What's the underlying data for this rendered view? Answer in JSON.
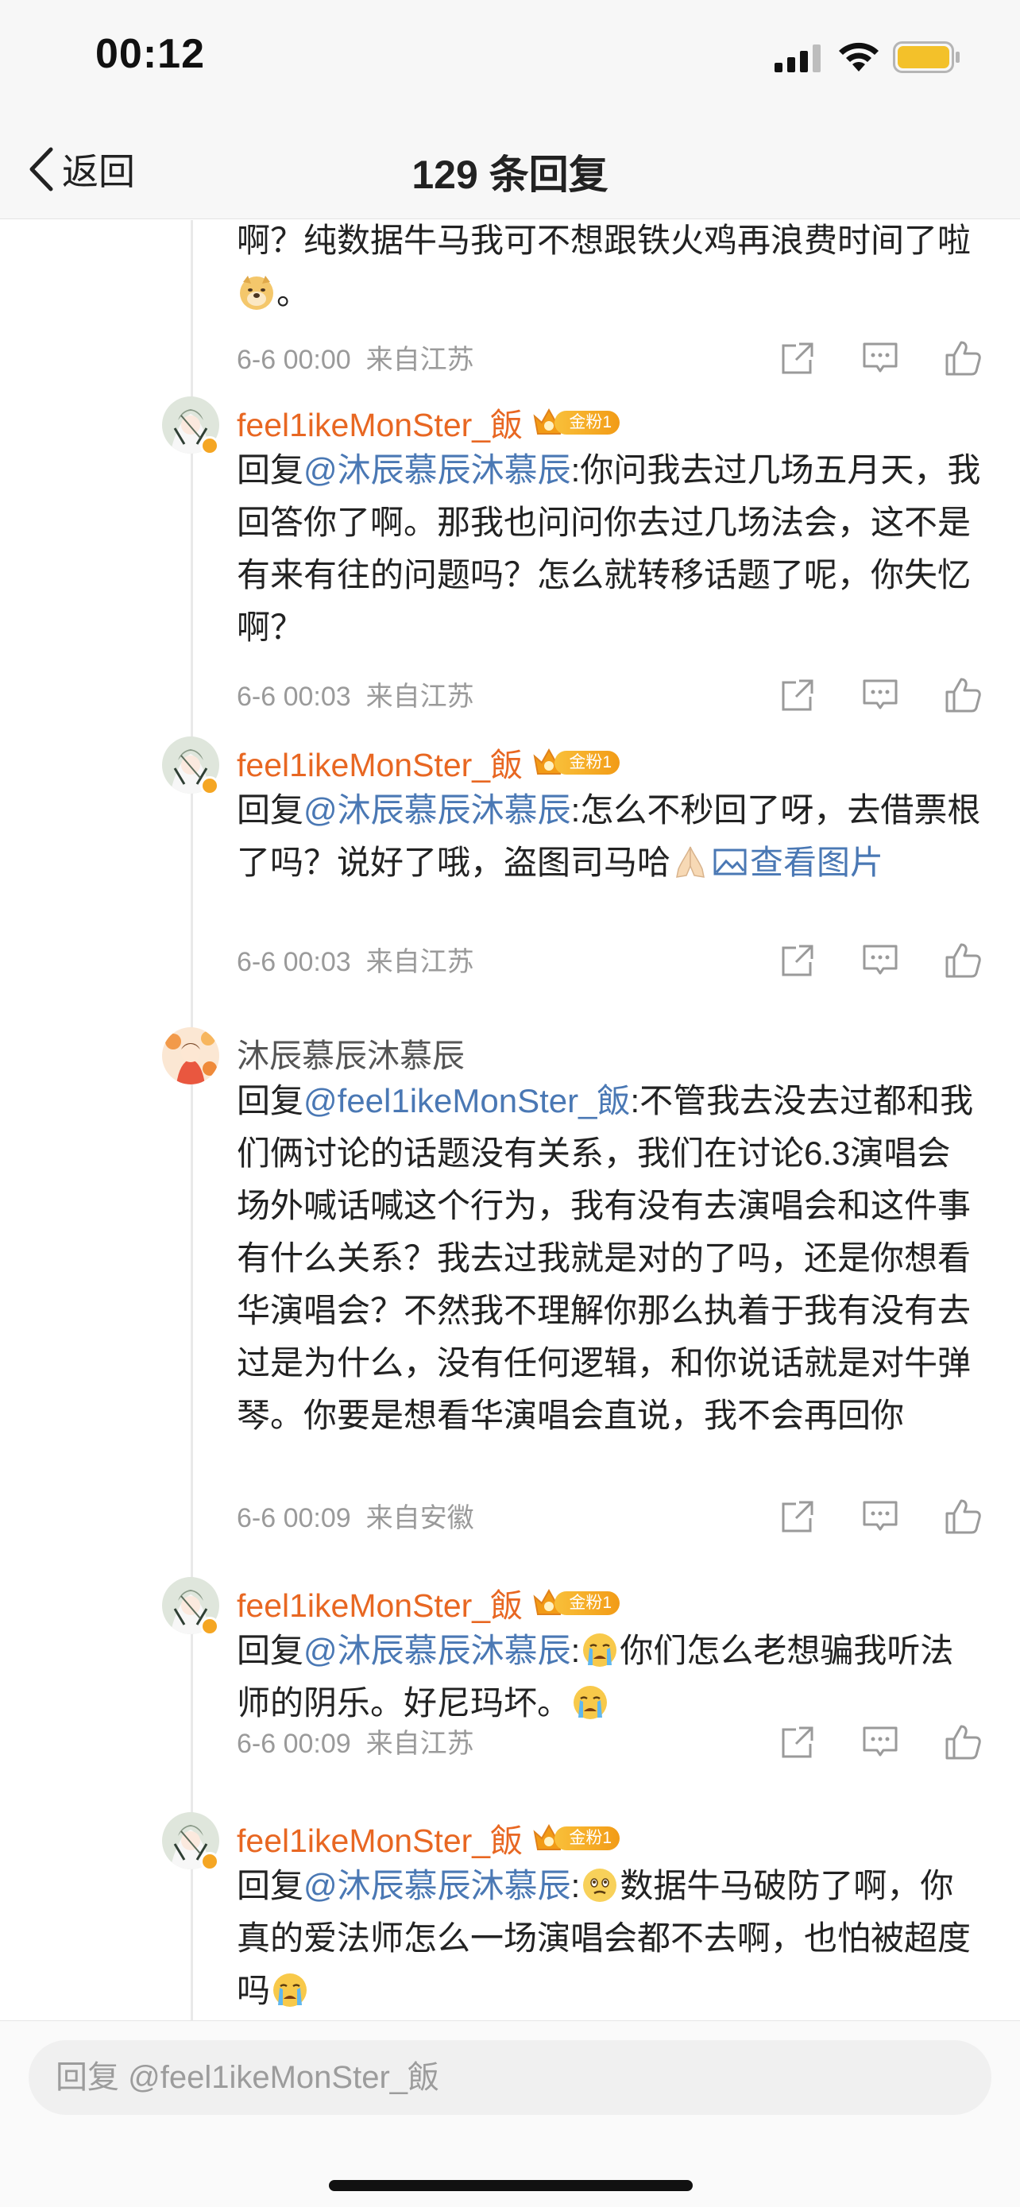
{
  "status_bar": {
    "time": "00:12"
  },
  "nav": {
    "back_label": "返回",
    "title": "129 条回复"
  },
  "replies": [
    {
      "body_pre": "啊？纯数据牛马我可不想跟铁火鸡再浪费时间了啦",
      "body_post": "。",
      "date": "6-6 00:00",
      "location": "来自江苏"
    },
    {
      "username": "feel1ikeMonSter_飯",
      "fan_badge": "金粉1",
      "reply_prefix": "回复",
      "mention": "@沐辰慕辰沐慕辰",
      "body": ":你问我去过几场五月天，我回答你了啊。那我也问问你去过几场法会，这不是有来有往的问题吗？怎么就转移话题了呢，你失忆啊？",
      "date": "6-6 00:03",
      "location": "来自江苏"
    },
    {
      "username": "feel1ikeMonSter_飯",
      "fan_badge": "金粉1",
      "reply_prefix": "回复",
      "mention": "@沐辰慕辰沐慕辰",
      "body": ":怎么不秒回了呀，去借票根了吗？说好了哦，盗图司马哈",
      "link": "查看图片",
      "date": "6-6 00:03",
      "location": "来自江苏"
    },
    {
      "username": "沐辰慕辰沐慕辰",
      "reply_prefix": "回复",
      "mention": "@feel1ikeMonSter_飯",
      "body": ":不管我去没去过都和我们俩讨论的话题没有关系，我们在讨论6.3演唱会场外喊话喊这个行为，我有没有去演唱会和这件事有什么关系？我去过我就是对的了吗，还是你想看华演唱会？不然我不理解你那么执着于我有没有去过是为什么，没有任何逻辑，和你说话就是对牛弹琴。你要是想看华演唱会直说，我不会再回你",
      "date": "6-6 00:09",
      "location": "来自安徽"
    },
    {
      "username": "feel1ikeMonSter_飯",
      "fan_badge": "金粉1",
      "reply_prefix": "回复",
      "mention": "@沐辰慕辰沐慕辰",
      "body_pre": ":",
      "body": "你们怎么老想骗我听法师的阴乐。好尼玛坏。",
      "date": "6-6 00:09",
      "location": "来自江苏"
    },
    {
      "username": "feel1ikeMonSter_飯",
      "fan_badge": "金粉1",
      "reply_prefix": "回复",
      "mention": "@沐辰慕辰沐慕辰",
      "body_pre": ":",
      "body": "数据牛马破防了啊，你真的爱法师怎么一场演唱会都不去啊，也怕被超度吗",
      "date": "",
      "location": ""
    }
  ],
  "composer": {
    "placeholder": "回复 @feel1ikeMonSter_飯"
  },
  "icons": {
    "share": "share-icon",
    "comment": "comment-icon",
    "like": "like-icon",
    "emoji_doge": "doge-emoji-icon",
    "emoji_pray": "pray-emoji-icon",
    "emoji_cry": "crying-emoji-icon",
    "emoji_sad": "sad-emoji-icon",
    "image": "image-icon"
  },
  "colors": {
    "username": "#e86722",
    "mention": "#4a78b4",
    "meta": "#9a9a9a",
    "fan_badge": "#f29b16"
  }
}
